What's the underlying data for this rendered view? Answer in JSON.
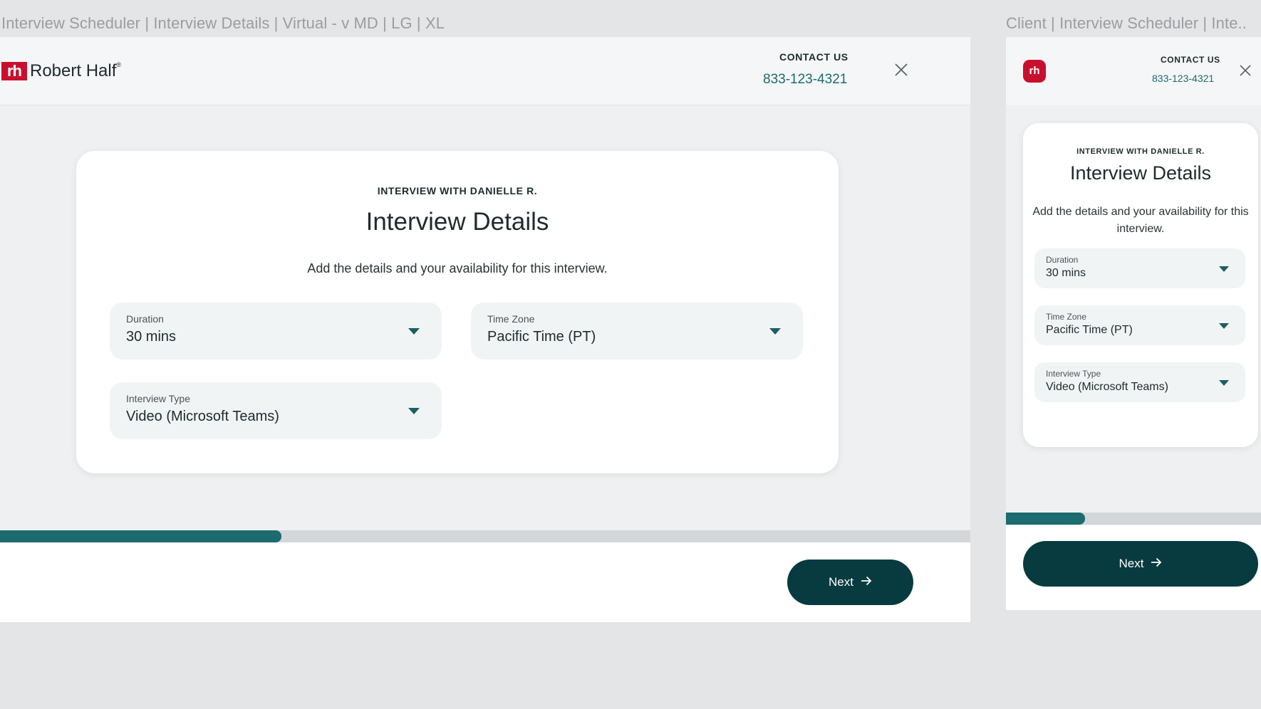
{
  "frames": {
    "large_title": "Interview Scheduler | Interview Details | Virtual - v MD | LG | XL",
    "small_title": "Client | Interview Scheduler | Inte.."
  },
  "brand": {
    "name": "Robert Half",
    "mark": "rh",
    "registered": "®",
    "color": "#c8102e"
  },
  "header": {
    "contact_label": "CONTACT US",
    "phone": "833-123-4321",
    "close_icon": "close-icon"
  },
  "card": {
    "eyebrow": "INTERVIEW WITH DANIELLE R.",
    "title": "Interview Details",
    "description": "Add the details and your availability for this interview."
  },
  "fields": {
    "duration": {
      "label": "Duration",
      "value": "30 mins"
    },
    "time_zone": {
      "label": "Time Zone",
      "value": "Pacific Time (PT)"
    },
    "interview_type": {
      "label": "Interview Type",
      "value": "Video (Microsoft Teams)"
    }
  },
  "progress": {
    "fraction": 0.29
  },
  "footer": {
    "next_label": "Next",
    "arrow_icon": "arrow-right-icon"
  },
  "colors": {
    "accent": "#1b6b70",
    "button": "#083b40",
    "phone": "#1f6a6e"
  }
}
